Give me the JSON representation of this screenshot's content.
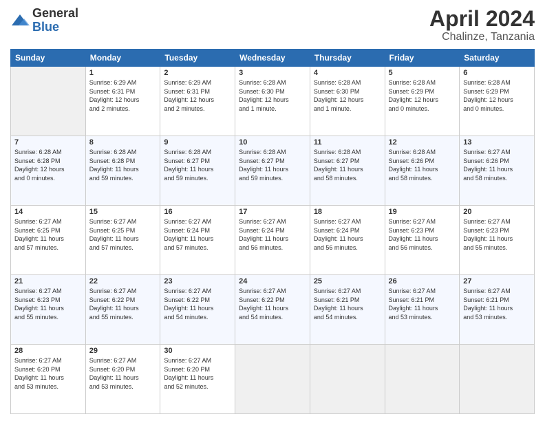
{
  "logo": {
    "general": "General",
    "blue": "Blue"
  },
  "header": {
    "month": "April 2024",
    "location": "Chalinze, Tanzania"
  },
  "weekdays": [
    "Sunday",
    "Monday",
    "Tuesday",
    "Wednesday",
    "Thursday",
    "Friday",
    "Saturday"
  ],
  "weeks": [
    [
      {
        "day": "",
        "info": ""
      },
      {
        "day": "1",
        "info": "Sunrise: 6:29 AM\nSunset: 6:31 PM\nDaylight: 12 hours\nand 2 minutes."
      },
      {
        "day": "2",
        "info": "Sunrise: 6:29 AM\nSunset: 6:31 PM\nDaylight: 12 hours\nand 2 minutes."
      },
      {
        "day": "3",
        "info": "Sunrise: 6:28 AM\nSunset: 6:30 PM\nDaylight: 12 hours\nand 1 minute."
      },
      {
        "day": "4",
        "info": "Sunrise: 6:28 AM\nSunset: 6:30 PM\nDaylight: 12 hours\nand 1 minute."
      },
      {
        "day": "5",
        "info": "Sunrise: 6:28 AM\nSunset: 6:29 PM\nDaylight: 12 hours\nand 0 minutes."
      },
      {
        "day": "6",
        "info": "Sunrise: 6:28 AM\nSunset: 6:29 PM\nDaylight: 12 hours\nand 0 minutes."
      }
    ],
    [
      {
        "day": "7",
        "info": "Sunrise: 6:28 AM\nSunset: 6:28 PM\nDaylight: 12 hours\nand 0 minutes."
      },
      {
        "day": "8",
        "info": "Sunrise: 6:28 AM\nSunset: 6:28 PM\nDaylight: 11 hours\nand 59 minutes."
      },
      {
        "day": "9",
        "info": "Sunrise: 6:28 AM\nSunset: 6:27 PM\nDaylight: 11 hours\nand 59 minutes."
      },
      {
        "day": "10",
        "info": "Sunrise: 6:28 AM\nSunset: 6:27 PM\nDaylight: 11 hours\nand 59 minutes."
      },
      {
        "day": "11",
        "info": "Sunrise: 6:28 AM\nSunset: 6:27 PM\nDaylight: 11 hours\nand 58 minutes."
      },
      {
        "day": "12",
        "info": "Sunrise: 6:28 AM\nSunset: 6:26 PM\nDaylight: 11 hours\nand 58 minutes."
      },
      {
        "day": "13",
        "info": "Sunrise: 6:27 AM\nSunset: 6:26 PM\nDaylight: 11 hours\nand 58 minutes."
      }
    ],
    [
      {
        "day": "14",
        "info": "Sunrise: 6:27 AM\nSunset: 6:25 PM\nDaylight: 11 hours\nand 57 minutes."
      },
      {
        "day": "15",
        "info": "Sunrise: 6:27 AM\nSunset: 6:25 PM\nDaylight: 11 hours\nand 57 minutes."
      },
      {
        "day": "16",
        "info": "Sunrise: 6:27 AM\nSunset: 6:24 PM\nDaylight: 11 hours\nand 57 minutes."
      },
      {
        "day": "17",
        "info": "Sunrise: 6:27 AM\nSunset: 6:24 PM\nDaylight: 11 hours\nand 56 minutes."
      },
      {
        "day": "18",
        "info": "Sunrise: 6:27 AM\nSunset: 6:24 PM\nDaylight: 11 hours\nand 56 minutes."
      },
      {
        "day": "19",
        "info": "Sunrise: 6:27 AM\nSunset: 6:23 PM\nDaylight: 11 hours\nand 56 minutes."
      },
      {
        "day": "20",
        "info": "Sunrise: 6:27 AM\nSunset: 6:23 PM\nDaylight: 11 hours\nand 55 minutes."
      }
    ],
    [
      {
        "day": "21",
        "info": "Sunrise: 6:27 AM\nSunset: 6:23 PM\nDaylight: 11 hours\nand 55 minutes."
      },
      {
        "day": "22",
        "info": "Sunrise: 6:27 AM\nSunset: 6:22 PM\nDaylight: 11 hours\nand 55 minutes."
      },
      {
        "day": "23",
        "info": "Sunrise: 6:27 AM\nSunset: 6:22 PM\nDaylight: 11 hours\nand 54 minutes."
      },
      {
        "day": "24",
        "info": "Sunrise: 6:27 AM\nSunset: 6:22 PM\nDaylight: 11 hours\nand 54 minutes."
      },
      {
        "day": "25",
        "info": "Sunrise: 6:27 AM\nSunset: 6:21 PM\nDaylight: 11 hours\nand 54 minutes."
      },
      {
        "day": "26",
        "info": "Sunrise: 6:27 AM\nSunset: 6:21 PM\nDaylight: 11 hours\nand 53 minutes."
      },
      {
        "day": "27",
        "info": "Sunrise: 6:27 AM\nSunset: 6:21 PM\nDaylight: 11 hours\nand 53 minutes."
      }
    ],
    [
      {
        "day": "28",
        "info": "Sunrise: 6:27 AM\nSunset: 6:20 PM\nDaylight: 11 hours\nand 53 minutes."
      },
      {
        "day": "29",
        "info": "Sunrise: 6:27 AM\nSunset: 6:20 PM\nDaylight: 11 hours\nand 53 minutes."
      },
      {
        "day": "30",
        "info": "Sunrise: 6:27 AM\nSunset: 6:20 PM\nDaylight: 11 hours\nand 52 minutes."
      },
      {
        "day": "",
        "info": ""
      },
      {
        "day": "",
        "info": ""
      },
      {
        "day": "",
        "info": ""
      },
      {
        "day": "",
        "info": ""
      }
    ]
  ]
}
